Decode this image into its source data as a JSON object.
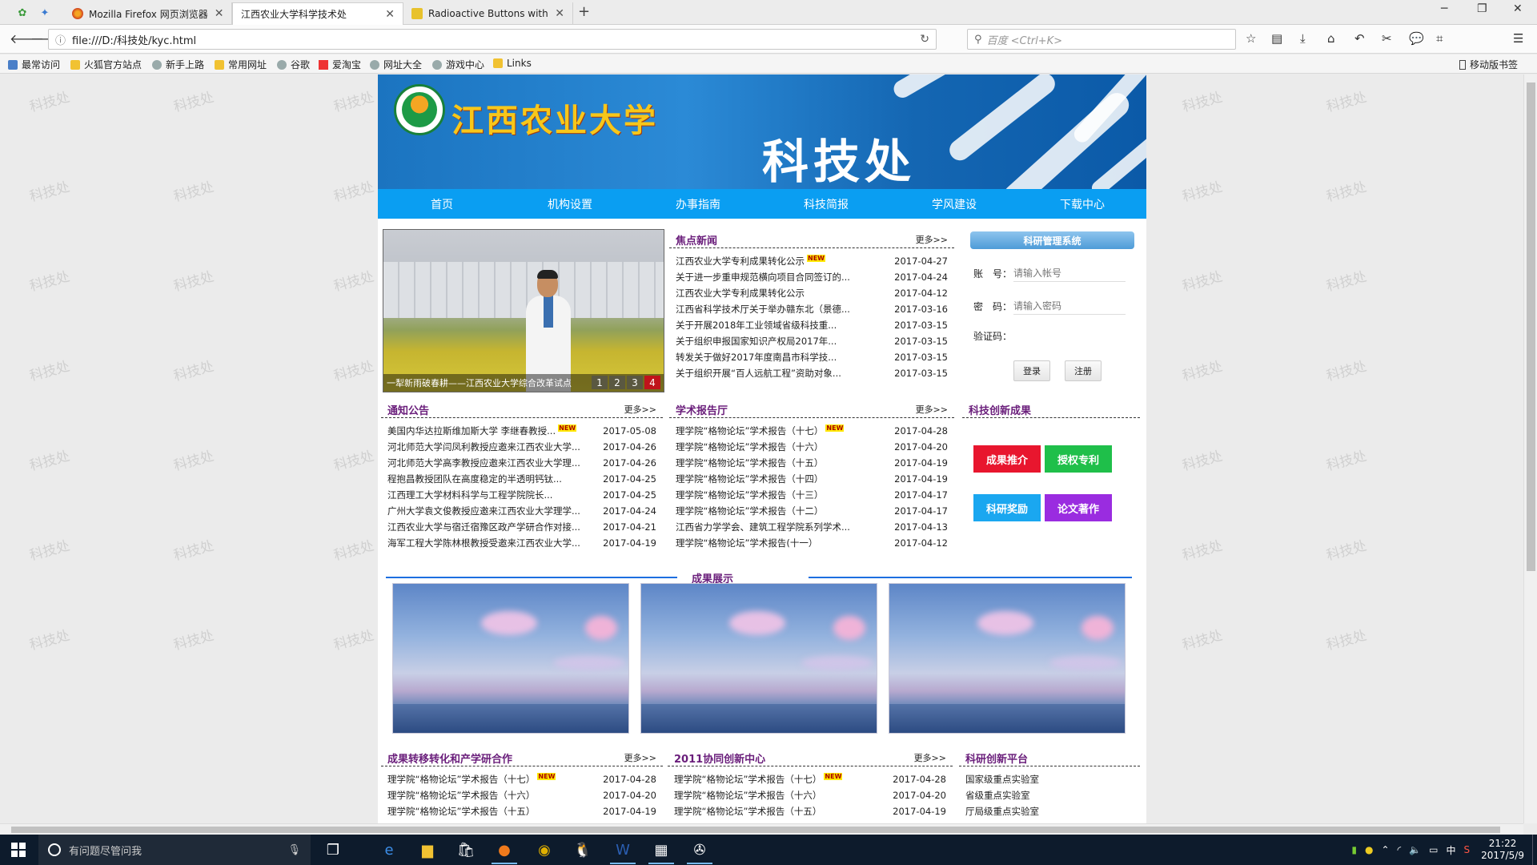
{
  "browser": {
    "tabs": [
      {
        "title": "Mozilla Firefox 网页浏览器",
        "active": false
      },
      {
        "title": "江西农业大学科学技术处",
        "active": true
      },
      {
        "title": "Radioactive Buttons with",
        "active": false
      }
    ],
    "url": "file:///D:/科技处/kyc.html",
    "search_placeholder": "百度 <Ctrl+K>",
    "bookmarks": [
      "最常访问",
      "火狐官方站点",
      "新手上路",
      "常用网址",
      "谷歌",
      "爱淘宝",
      "网址大全",
      "游戏中心",
      "Links"
    ],
    "mobile_bookmarks": "移动版书签"
  },
  "watermark": "科技处",
  "site": {
    "university_name": "江西农业大学",
    "banner_title": "科技处",
    "nav": [
      "首页",
      "机构设置",
      "办事指南",
      "科技简报",
      "学风建设",
      "下载中心"
    ],
    "slideshow": {
      "caption": "一犁新雨破春耕——江西农业大学综合改革试点",
      "pages": [
        "1",
        "2",
        "3",
        "4"
      ],
      "current_page": 4
    },
    "focus_news": {
      "title": "焦点新闻",
      "more": "更多>>",
      "items": [
        {
          "text": "江西农业大学专利成果转化公示",
          "date": "2017-04-27",
          "new": true
        },
        {
          "text": "关于进一步重申规范横向项目合同签订的...",
          "date": "2017-04-24"
        },
        {
          "text": "江西农业大学专利成果转化公示",
          "date": "2017-04-12"
        },
        {
          "text": "江西省科学技术厅关于举办赣东北（景德...",
          "date": "2017-03-16"
        },
        {
          "text": "关于开展2018年工业领域省级科技重...",
          "date": "2017-03-15"
        },
        {
          "text": "关于组织申报国家知识产权局2017年...",
          "date": "2017-03-15"
        },
        {
          "text": "转发关于做好2017年度南昌市科学技...",
          "date": "2017-03-15"
        },
        {
          "text": "关于组织开展“百人远航工程”资助对象...",
          "date": "2017-03-15"
        }
      ]
    },
    "research_system": {
      "title": "科研管理系统",
      "account_label": "账　号：",
      "account_placeholder": "请输入帐号",
      "password_label": "密　码：",
      "password_placeholder": "请输入密码",
      "captcha_label": "验证码：",
      "login": "登录",
      "register": "注册"
    },
    "notices": {
      "title": "通知公告",
      "more": "更多>>",
      "items": [
        {
          "text": "美国内华达拉斯维加斯大学 李继春教授...",
          "date": "2017-05-08",
          "new": true
        },
        {
          "text": "河北师范大学闫凤利教授应邀来江西农业大学...",
          "date": "2017-04-26"
        },
        {
          "text": "河北师范大学高李教授应邀来江西农业大学理...",
          "date": "2017-04-26"
        },
        {
          "text": "程抱昌教授团队在高度稳定的半透明钙钛...",
          "date": "2017-04-25"
        },
        {
          "text": "江西理工大学材料科学与工程学院院长...",
          "date": "2017-04-25"
        },
        {
          "text": "广州大学袁文俊教授应邀来江西农业大学理学...",
          "date": "2017-04-24"
        },
        {
          "text": "江西农业大学与宿迁宿豫区政产学研合作对接...",
          "date": "2017-04-21"
        },
        {
          "text": "海军工程大学陈林根教授受邀来江西农业大学...",
          "date": "2017-04-19"
        }
      ]
    },
    "lectures": {
      "title": "学术报告厅",
      "more": "更多>>",
      "items": [
        {
          "text": "理学院“格物论坛”学术报告（十七）",
          "date": "2017-04-28",
          "new": true
        },
        {
          "text": "理学院“格物论坛”学术报告（十六）",
          "date": "2017-04-20"
        },
        {
          "text": "理学院“格物论坛”学术报告（十五）",
          "date": "2017-04-19"
        },
        {
          "text": "理学院“格物论坛”学术报告（十四）",
          "date": "2017-04-19"
        },
        {
          "text": "理学院“格物论坛”学术报告（十三）",
          "date": "2017-04-17"
        },
        {
          "text": "理学院“格物论坛”学术报告（十二）",
          "date": "2017-04-17"
        },
        {
          "text": "江西省力学学会、建筑工程学院系列学术...",
          "date": "2017-04-13"
        },
        {
          "text": "理学院“格物论坛”学术报告(十一）",
          "date": "2017-04-12"
        }
      ]
    },
    "innovation": {
      "title": "科技创新成果",
      "buttons": [
        {
          "label": "成果推介",
          "color": "#e8162e"
        },
        {
          "label": "授权专利",
          "color": "#1fbf4a"
        },
        {
          "label": "科研奖励",
          "color": "#1aa7f0"
        },
        {
          "label": "论文著作",
          "color": "#9a2ce0"
        }
      ]
    },
    "showcase_title": "成果展示",
    "transfer": {
      "title": "成果转移转化和产学研合作",
      "more": "更多>>",
      "items": [
        {
          "text": "理学院“格物论坛”学术报告（十七）",
          "date": "2017-04-28",
          "new": true
        },
        {
          "text": "理学院“格物论坛”学术报告（十六）",
          "date": "2017-04-20"
        },
        {
          "text": "理学院“格物论坛”学术报告（十五）",
          "date": "2017-04-19"
        }
      ]
    },
    "center2011": {
      "title": "2011协同创新中心",
      "more": "更多>>",
      "items": [
        {
          "text": "理学院“格物论坛”学术报告（十七）",
          "date": "2017-04-28",
          "new": true
        },
        {
          "text": "理学院“格物论坛”学术报告（十六）",
          "date": "2017-04-20"
        },
        {
          "text": "理学院“格物论坛”学术报告（十五）",
          "date": "2017-04-19"
        }
      ]
    },
    "platform": {
      "title": "科研创新平台",
      "items": [
        "国家级重点实验室",
        "省级重点实验室",
        "厅局级重点实验室"
      ]
    }
  },
  "taskbar": {
    "search_placeholder": "有问题尽管问我",
    "time": "21:22",
    "date": "2017/5/9",
    "ime": "中"
  }
}
